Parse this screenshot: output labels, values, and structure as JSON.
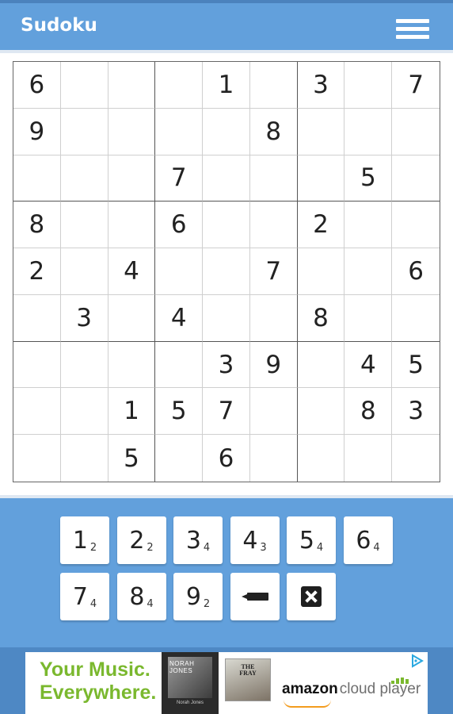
{
  "app_bar": {
    "title": "Sudoku",
    "menu_icon": "hamburger-menu-icon",
    "color": "#62a0dc"
  },
  "board": {
    "rows": [
      [
        "6",
        "",
        "",
        "",
        "1",
        "",
        "3",
        "",
        "7"
      ],
      [
        "9",
        "",
        "",
        "",
        "",
        "8",
        "",
        "",
        ""
      ],
      [
        "",
        "",
        "",
        "7",
        "",
        "",
        "",
        "5",
        ""
      ],
      [
        "8",
        "",
        "",
        "6",
        "",
        "",
        "2",
        "",
        ""
      ],
      [
        "2",
        "",
        "4",
        "",
        "",
        "7",
        "",
        "",
        "6"
      ],
      [
        "",
        "3",
        "",
        "4",
        "",
        "",
        "8",
        "",
        ""
      ],
      [
        "",
        "",
        "",
        "",
        "3",
        "9",
        "",
        "4",
        "5"
      ],
      [
        "",
        "",
        "1",
        "5",
        "7",
        "",
        "",
        "8",
        "3"
      ],
      [
        "",
        "",
        "5",
        "",
        "6",
        "",
        "",
        "",
        ""
      ]
    ]
  },
  "keypad": {
    "numbers": [
      {
        "digit": "1",
        "remaining": "2"
      },
      {
        "digit": "2",
        "remaining": "2"
      },
      {
        "digit": "3",
        "remaining": "4"
      },
      {
        "digit": "4",
        "remaining": "3"
      },
      {
        "digit": "5",
        "remaining": "4"
      },
      {
        "digit": "6",
        "remaining": "4"
      },
      {
        "digit": "7",
        "remaining": "4"
      },
      {
        "digit": "8",
        "remaining": "4"
      },
      {
        "digit": "9",
        "remaining": "2"
      }
    ],
    "pencil_icon": "pencil-icon",
    "erase_icon": "erase-icon"
  },
  "ad": {
    "headline_line1": "Your Music.",
    "headline_line2": "Everywhere.",
    "album1_title": "NORAH JONES",
    "album1_artist": "Norah Jones",
    "album2_title": "THE FRAY",
    "brand": "amazon",
    "product": "cloud player",
    "adchoices_icon": "adchoices-icon"
  }
}
